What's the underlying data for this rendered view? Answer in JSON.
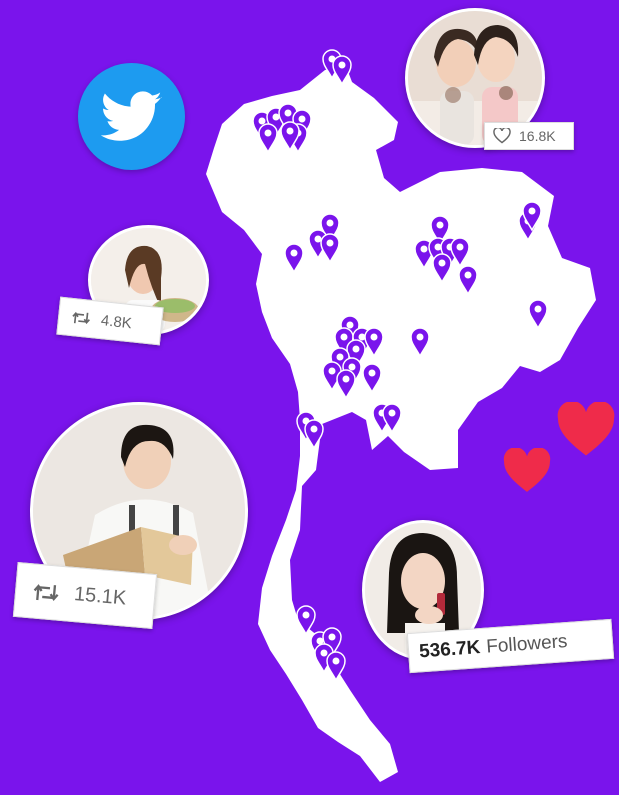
{
  "colors": {
    "background": "#7a14ec",
    "map": "#ffffff",
    "pin": "#7a14ec",
    "twitter_blue": "#1d9bf0",
    "heart": "#ef2b4a"
  },
  "icons": {
    "brand": "twitter-bird-icon",
    "like": "heart-outline-icon",
    "retweet": "retweet-icon",
    "decor": "heart-icon"
  },
  "cards": {
    "friends": {
      "like_count": "16.8K"
    },
    "woman_eating": {
      "retweet_count": "4.8K"
    },
    "man_reading": {
      "retweet_count": "15.1K"
    },
    "woman_lipstick": {
      "followers_count": "536.7K",
      "followers_label": "Followers"
    }
  }
}
